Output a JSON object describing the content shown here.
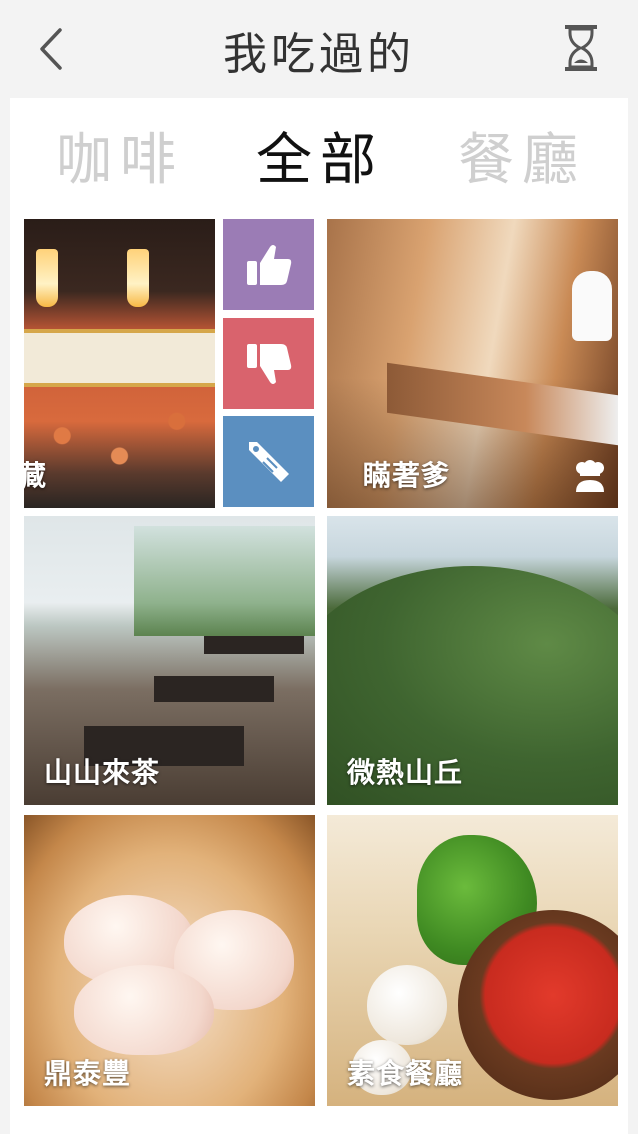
{
  "header": {
    "title": "我吃過的",
    "back_icon": "chevron-left-icon",
    "history_icon": "hourglass-icon"
  },
  "tabs": [
    {
      "label": "咖啡",
      "active": false
    },
    {
      "label": "全部",
      "active": true
    },
    {
      "label": "餐廳",
      "active": false
    }
  ],
  "actions": {
    "like": {
      "icon": "thumbs-up-icon",
      "color": "#9b7cb5"
    },
    "dislike": {
      "icon": "thumbs-down-icon",
      "color": "#d9636d"
    },
    "tag": {
      "icon": "tag-icon",
      "color": "#5b8fc0"
    }
  },
  "tiles": [
    {
      "label": "藏"
    },
    {
      "label": "瞞著爹",
      "badge_icon": "chef-icon"
    },
    {
      "label": "山山來茶"
    },
    {
      "label": "微熱山丘"
    },
    {
      "label": "鼎泰豐"
    },
    {
      "label": "素食餐廳"
    }
  ]
}
